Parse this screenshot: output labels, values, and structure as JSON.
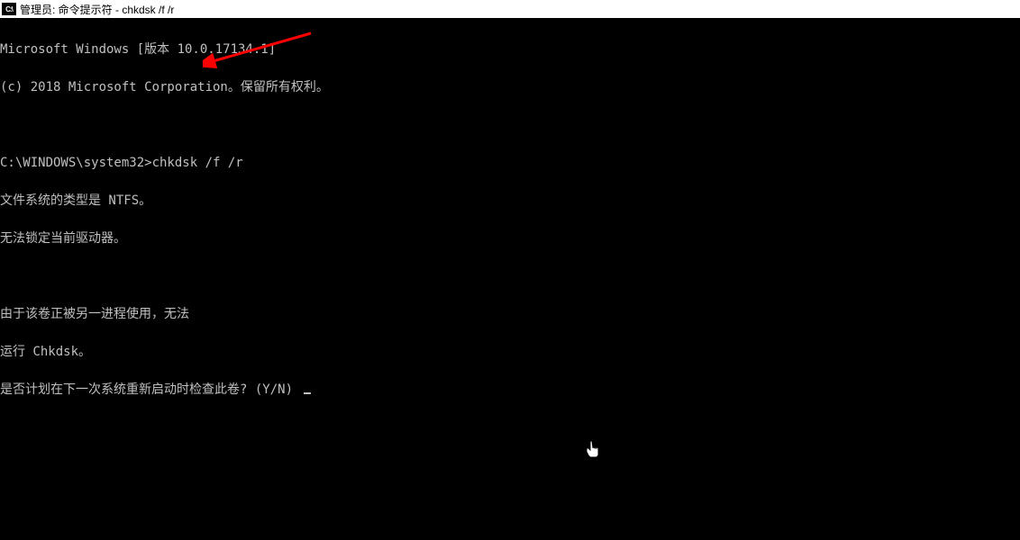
{
  "titlebar": {
    "icon_label": "C:\\",
    "text": "管理员: 命令提示符 - chkdsk  /f /r"
  },
  "terminal": {
    "lines": [
      "Microsoft Windows [版本 10.0.17134.1]",
      "(c) 2018 Microsoft Corporation。保留所有权利。",
      "",
      "C:\\WINDOWS\\system32>chkdsk /f /r",
      "文件系统的类型是 NTFS。",
      "无法锁定当前驱动器。",
      "",
      "由于该卷正被另一进程使用，无法",
      "运行 Chkdsk。",
      "是否计划在下一次系统重新启动时检查此卷? (Y/N) "
    ],
    "prompt_path": "C:\\WINDOWS\\system32>",
    "command": "chkdsk /f /r"
  },
  "annotation": {
    "arrow_color": "#ff0000"
  }
}
